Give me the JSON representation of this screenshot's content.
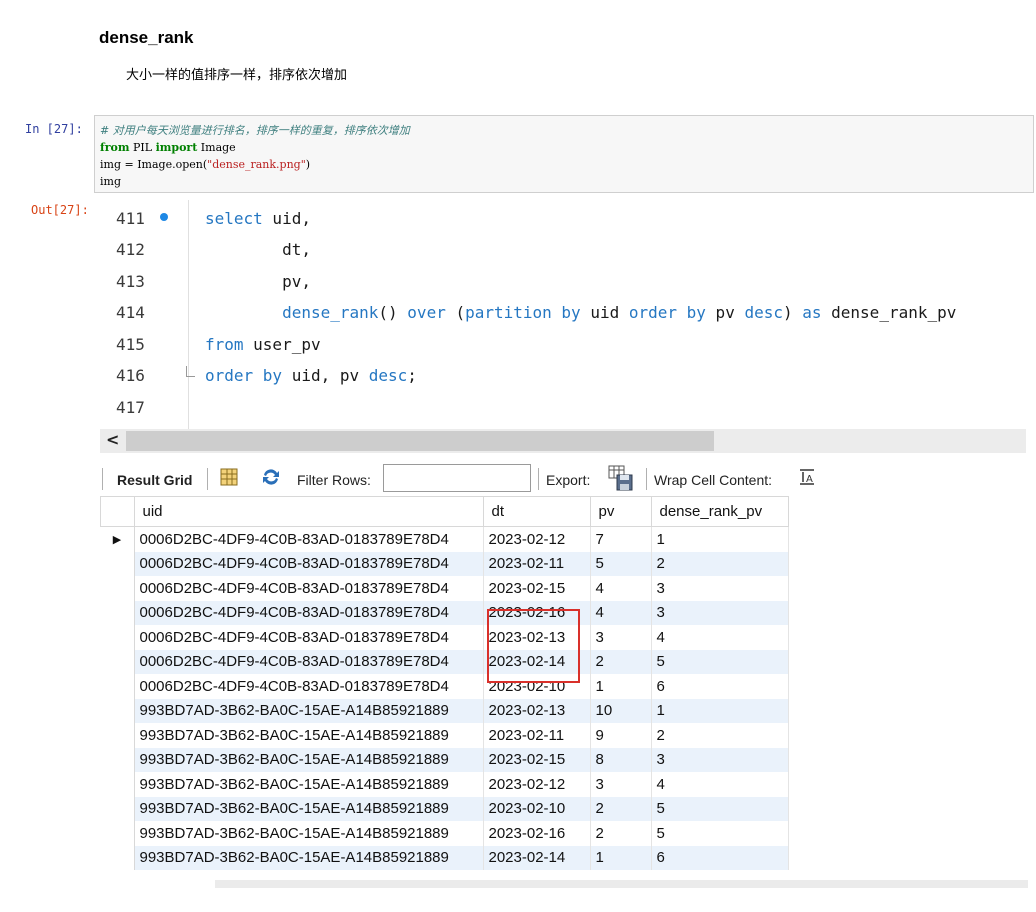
{
  "section": {
    "title": "dense_rank",
    "description": "大小一样的值排序一样，排序依次增加"
  },
  "input_cell": {
    "prompt": "In [27]:",
    "lines": {
      "comment": "# 对用户每天浏览量进行排名，排序一样的重复，排序依次增加",
      "l2_kw1": "from",
      "l2_mod": " PIL ",
      "l2_kw2": "import",
      "l2_name": " Image",
      "l3_code": "img = Image.open(",
      "l3_str": "\"dense_rank.png\"",
      "l3_end": ")",
      "l4": "img"
    }
  },
  "output_cell": {
    "prompt": "Out[27]:"
  },
  "editor": {
    "line_numbers": [
      "411",
      "412",
      "413",
      "414",
      "415",
      "416",
      "417"
    ],
    "sql": {
      "l1_kw": "select",
      "l1_rest": " uid,",
      "l2": "        dt,",
      "l3": "        pv,",
      "l4_indent": "        ",
      "l4_fn": "dense_rank",
      "l4_p1": "() ",
      "l4_over": "over",
      "l4_p2": " (",
      "l4_partition": "partition by",
      "l4_p3": " uid ",
      "l4_order": "order by",
      "l4_p4": " pv ",
      "l4_desc": "desc",
      "l4_p5": ") ",
      "l4_as": "as",
      "l4_p6": " dense_rank_pv",
      "l5_kw": "from",
      "l5_rest": " user_pv",
      "l6_kw": "order by",
      "l6_mid": " uid, pv ",
      "l6_desc": "desc",
      "l6_end": ";"
    }
  },
  "toolbar": {
    "result_grid": "Result Grid",
    "filter_rows": "Filter Rows:",
    "export": "Export:",
    "wrap_cell": "Wrap Cell Content:"
  },
  "grid": {
    "columns": [
      "uid",
      "dt",
      "pv",
      "dense_rank_pv"
    ],
    "rows": [
      [
        "0006D2BC-4DF9-4C0B-83AD-0183789E78D4",
        "2023-02-12",
        "7",
        "1"
      ],
      [
        "0006D2BC-4DF9-4C0B-83AD-0183789E78D4",
        "2023-02-11",
        "5",
        "2"
      ],
      [
        "0006D2BC-4DF9-4C0B-83AD-0183789E78D4",
        "2023-02-15",
        "4",
        "3"
      ],
      [
        "0006D2BC-4DF9-4C0B-83AD-0183789E78D4",
        "2023-02-16",
        "4",
        "3"
      ],
      [
        "0006D2BC-4DF9-4C0B-83AD-0183789E78D4",
        "2023-02-13",
        "3",
        "4"
      ],
      [
        "0006D2BC-4DF9-4C0B-83AD-0183789E78D4",
        "2023-02-14",
        "2",
        "5"
      ],
      [
        "0006D2BC-4DF9-4C0B-83AD-0183789E78D4",
        "2023-02-10",
        "1",
        "6"
      ],
      [
        "993BD7AD-3B62-BA0C-15AE-A14B85921889",
        "2023-02-13",
        "10",
        "1"
      ],
      [
        "993BD7AD-3B62-BA0C-15AE-A14B85921889",
        "2023-02-11",
        "9",
        "2"
      ],
      [
        "993BD7AD-3B62-BA0C-15AE-A14B85921889",
        "2023-02-15",
        "8",
        "3"
      ],
      [
        "993BD7AD-3B62-BA0C-15AE-A14B85921889",
        "2023-02-12",
        "3",
        "4"
      ],
      [
        "993BD7AD-3B62-BA0C-15AE-A14B85921889",
        "2023-02-10",
        "2",
        "5"
      ],
      [
        "993BD7AD-3B62-BA0C-15AE-A14B85921889",
        "2023-02-16",
        "2",
        "5"
      ],
      [
        "993BD7AD-3B62-BA0C-15AE-A14B85921889",
        "2023-02-14",
        "1",
        "6"
      ]
    ]
  },
  "colors": {
    "sql_keyword": "#2577c2",
    "highlight_box": "#d9302a",
    "row_alt": "#eaf2fb"
  }
}
